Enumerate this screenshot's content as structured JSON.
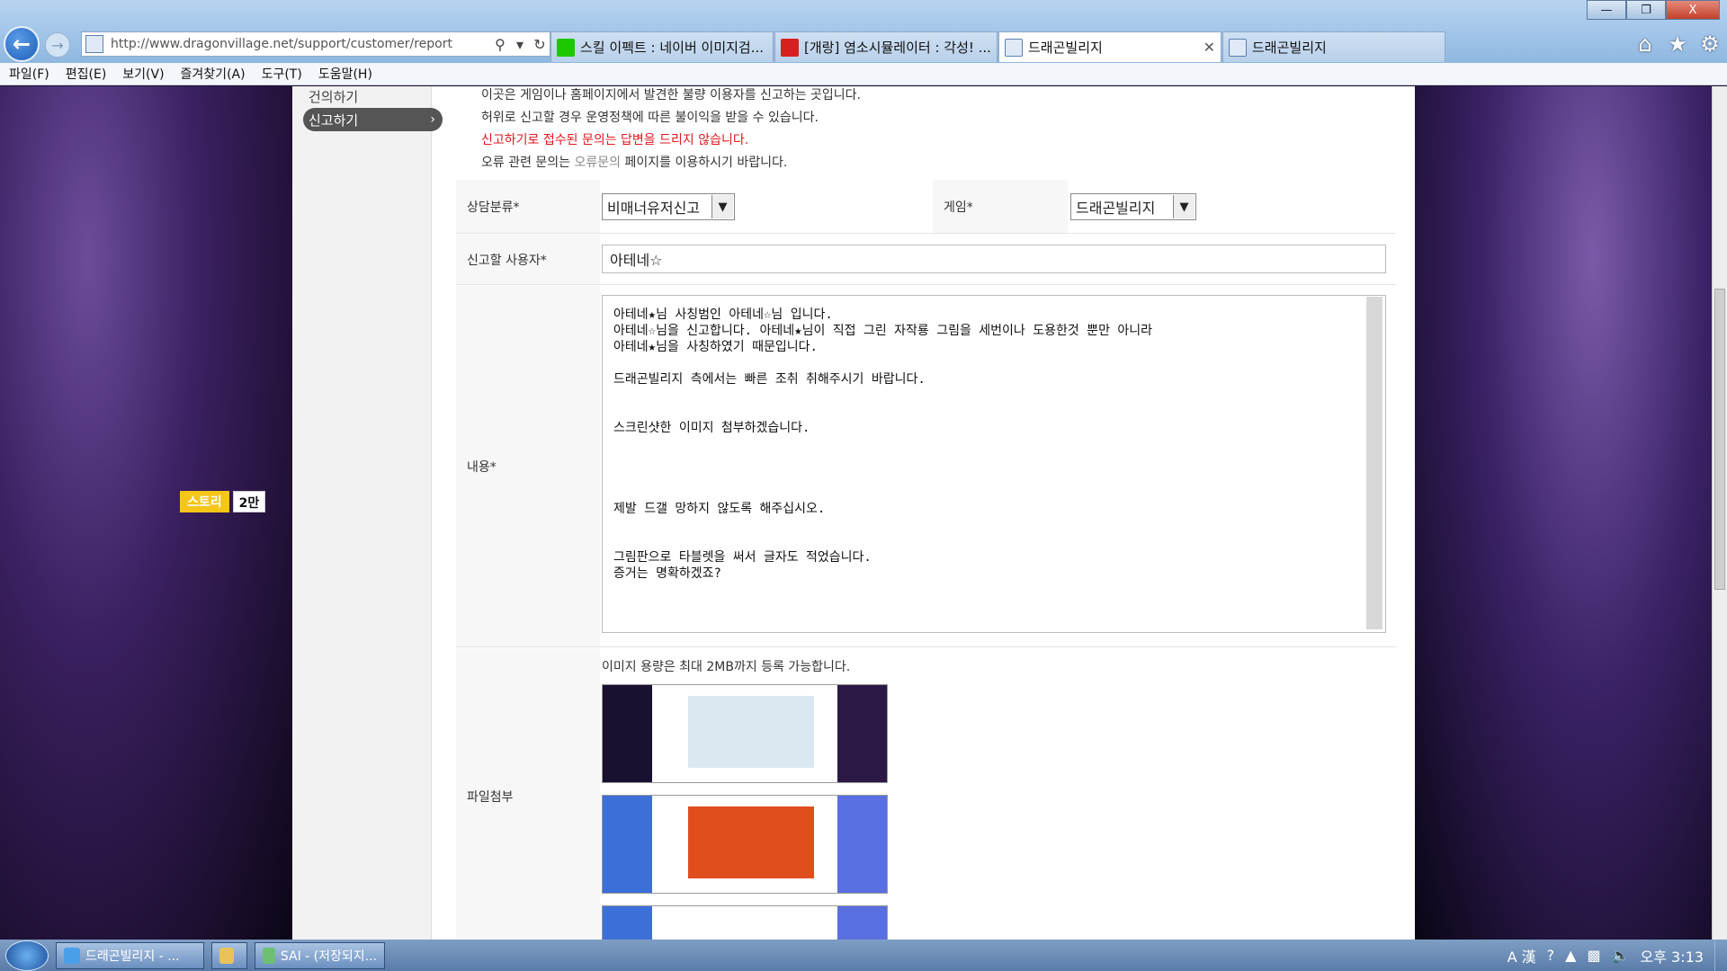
{
  "browser": {
    "url": "http://www.dragonvillage.net/support/customer/report",
    "tabs": [
      {
        "label": "스킬 이펙트 : 네이버 이미지검..."
      },
      {
        "label": "[개랑] 염소시뮬레이터 : 각성! ..."
      },
      {
        "label": "드래곤빌리지"
      },
      {
        "label": "드래곤빌리지"
      }
    ],
    "window_controls": {
      "minimize": "—",
      "maximize": "❐",
      "close": "X"
    },
    "menu": [
      "파일(F)",
      "편집(E)",
      "보기(V)",
      "즐겨찾기(A)",
      "도구(T)",
      "도움말(H)"
    ]
  },
  "sidebar": {
    "items": [
      {
        "label": "건의하기"
      },
      {
        "label": "신고하기"
      }
    ]
  },
  "notice": {
    "line1": "이곳은 게임이나 홈페이지에서 발견한 불량 이용자를 신고하는 곳입니다.",
    "line2": "허위로 신고할 경우 운영정책에 따른 불이익을 받을 수 있습니다.",
    "line3": "신고하기로 접수된 문의는 답변을 드리지 않습니다.",
    "line4_pre": "오류 관련 문의는 ",
    "line4_link": "오류문의",
    "line4_post": " 페이지를 이용하시기 바랍니다."
  },
  "form": {
    "category_label": "상담분류*",
    "category_value": "비매너유저신고",
    "game_label": "게임*",
    "game_value": "드래곤빌리지",
    "user_label": "신고할 사용자*",
    "user_value": "아테네☆",
    "content_label": "내용*",
    "content_value": "아테네★님 사칭범인 아테네☆님 입니다.\n아테네☆님을 신고합니다. 아테네★님이 직접 그린 자작룡 그림을 세번이나 도용한것 뿐만 아니라\n아테네★님을 사칭하였기 때문입니다.\n\n드래곤빌리지 측에서는 빠른 조취 취해주시기 바랍니다.\n\n\n스크린샷한 이미지 첨부하겠습니다.\n\n\n\n\n제발 드갤 망하지 않도록 해주십시오.\n\n\n그림판으로 타블렛을 써서 글자도 적었습니다.\n증거는 명확하겠죠?",
    "file_label": "파일첨부",
    "file_hint": "이미지 용량은 최대 2MB까지 등록 가능합니다."
  },
  "story_badge": {
    "label": "스토리",
    "count": "2만"
  },
  "taskbar": {
    "tasks": [
      {
        "label": "드래곤빌리지 - ..."
      },
      {
        "label": ""
      },
      {
        "label": "SAI - (저장되지..."
      }
    ],
    "ime": "A 漢",
    "time": "오후 3:13"
  },
  "colors": {
    "warning_text": "#e0181e",
    "nav_active_bg": "#555555",
    "story_badge": "#f5c518"
  }
}
